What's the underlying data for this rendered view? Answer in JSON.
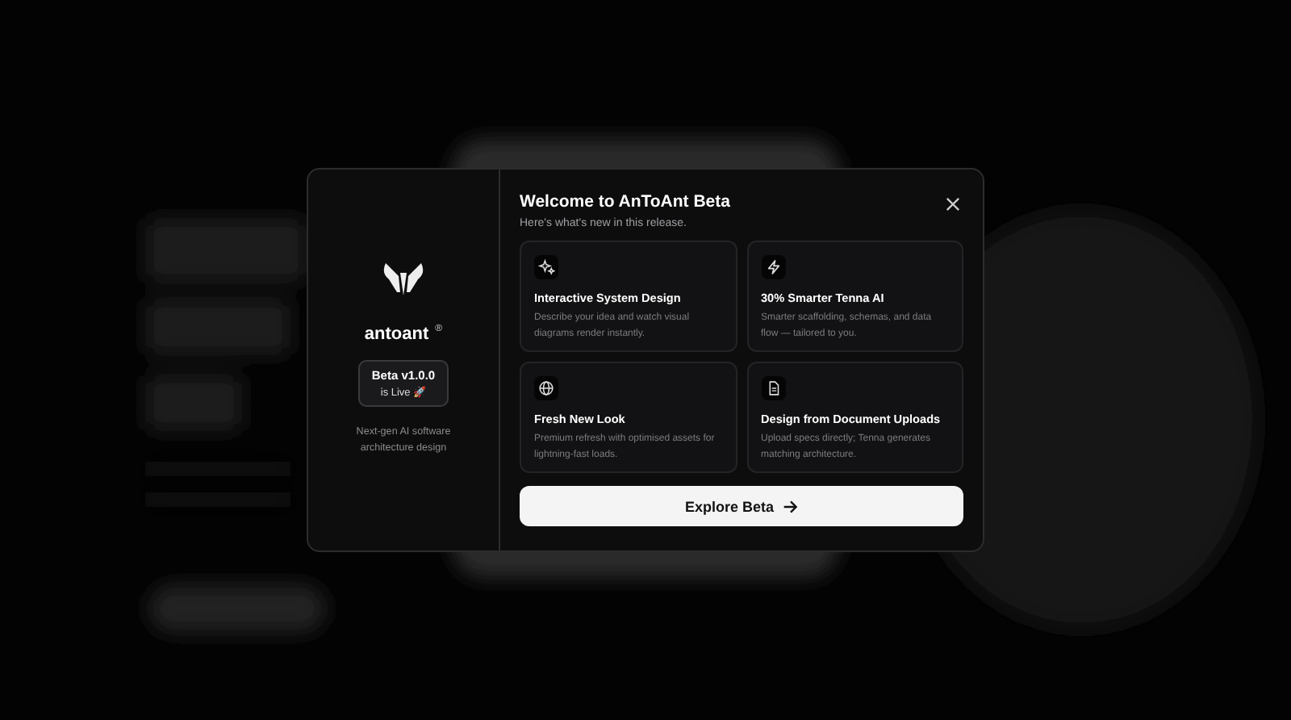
{
  "modal": {
    "brand": {
      "name": "antoant",
      "mark": "®",
      "badge_line_1": "Beta v1.0.0",
      "badge_line_2": "is Live 🚀",
      "tagline": "Next-gen AI software architecture design"
    },
    "title": "Welcome to AnToAnt Beta",
    "subtitle": "Here's what's new in this release.",
    "features": [
      {
        "title": "Interactive System Design",
        "text": "Describe your idea and watch visual diagrams render instantly."
      },
      {
        "title": "30% Smarter Tenna AI",
        "text": "Smarter scaffolding, schemas, and data flow — tailored to you."
      },
      {
        "title": "Fresh New Look",
        "text": "Premium refresh with optimised assets for lightning-fast loads."
      },
      {
        "title": "Design from Document Uploads",
        "text": "Upload specs directly; Tenna generates matching architecture."
      }
    ],
    "button": "Explore Beta"
  }
}
